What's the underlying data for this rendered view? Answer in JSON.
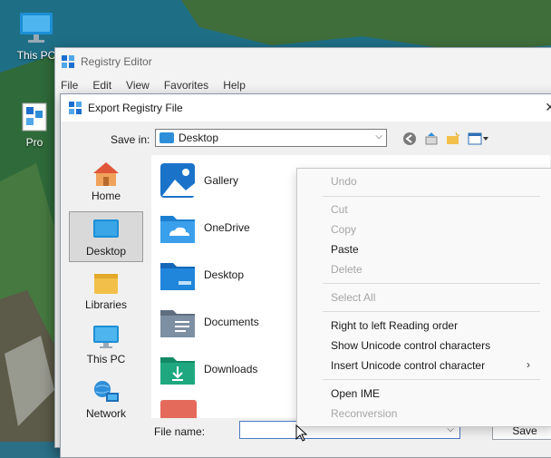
{
  "desktop": {
    "icons": [
      {
        "label": "This PC",
        "icon": "monitor-icon"
      },
      {
        "label": "Pro",
        "icon": "registry-icon"
      }
    ]
  },
  "registry_editor": {
    "title": "Registry Editor",
    "menu": [
      "File",
      "Edit",
      "View",
      "Favorites",
      "Help"
    ]
  },
  "dialog": {
    "title": "Export Registry File",
    "save_in_label": "Save in:",
    "save_in_value": "Desktop",
    "places": [
      {
        "label": "Home",
        "icon": "home-icon"
      },
      {
        "label": "Desktop",
        "icon": "desktop-icon",
        "selected": true
      },
      {
        "label": "Libraries",
        "icon": "libraries-icon"
      },
      {
        "label": "This PC",
        "icon": "monitor-icon"
      },
      {
        "label": "Network",
        "icon": "network-icon"
      }
    ],
    "files": [
      {
        "label": "Gallery",
        "icon": "gallery-icon"
      },
      {
        "label": "OneDrive",
        "icon": "onedrive-folder-icon"
      },
      {
        "label": "Desktop",
        "icon": "desktop-folder-icon"
      },
      {
        "label": "Documents",
        "icon": "documents-folder-icon"
      },
      {
        "label": "Downloads",
        "icon": "downloads-folder-icon"
      }
    ],
    "file_name_label": "File name:",
    "file_name_value": "",
    "save_label": "Save"
  },
  "context_menu": {
    "items": [
      {
        "label": "Undo",
        "disabled": true
      },
      {
        "label": "Cut",
        "disabled": true
      },
      {
        "label": "Copy",
        "disabled": true
      },
      {
        "label": "Paste",
        "disabled": false
      },
      {
        "label": "Delete",
        "disabled": true
      },
      {
        "label": "Select All",
        "disabled": true
      },
      {
        "label": "Right to left Reading order",
        "disabled": false
      },
      {
        "label": "Show Unicode control characters",
        "disabled": false
      },
      {
        "label": "Insert Unicode control character",
        "disabled": false,
        "submenu": true
      },
      {
        "label": "Open IME",
        "disabled": false
      },
      {
        "label": "Reconversion",
        "disabled": true
      }
    ],
    "submenu_arrow": "›"
  },
  "colors": {
    "accent": "#2f8ed8",
    "disabled_text": "#a6a6a6"
  }
}
